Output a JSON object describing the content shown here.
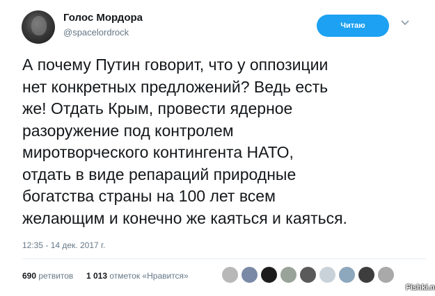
{
  "author": {
    "display_name": "Голос Мордора",
    "handle": "@spacelordrock"
  },
  "follow_button": {
    "label": "Читаю"
  },
  "tweet": {
    "lines": [
      "А почему Путин говорит, что у оппозиции",
      "нет конкретных предложений? Ведь есть",
      "же! Отдать Крым, провести ядерное",
      "разоружение под контролем",
      "миротворческого контингента НАТО,",
      "отдать в виде репараций природные",
      "богатства страны на 100 лет всем",
      "желающим и конечно же каяться и каяться."
    ],
    "timestamp": "12:35 - 14 дек. 2017 г."
  },
  "stats": {
    "retweets_count": "690",
    "retweets_label": "ретвитов",
    "likes_count": "1 013",
    "likes_label": "отметок «Нравится»"
  },
  "likers": [
    {
      "icon": "avatar",
      "color": "#b8b8b8"
    },
    {
      "icon": "avatar",
      "color": "#7a8aa6"
    },
    {
      "icon": "avatar",
      "color": "#1c1c1c"
    },
    {
      "icon": "avatar",
      "color": "#9aa39a"
    },
    {
      "icon": "avatar",
      "color": "#5a5a5a"
    },
    {
      "icon": "avatar",
      "color": "#c9d2d8"
    },
    {
      "icon": "avatar",
      "color": "#8da7bd"
    },
    {
      "icon": "avatar",
      "color": "#3d3d3d"
    },
    {
      "icon": "avatar",
      "color": "#a9a9a9"
    }
  ],
  "watermark": "Fishki.net",
  "colors": {
    "accent": "#1da1f2",
    "text": "#14171a",
    "muted": "#657786"
  }
}
